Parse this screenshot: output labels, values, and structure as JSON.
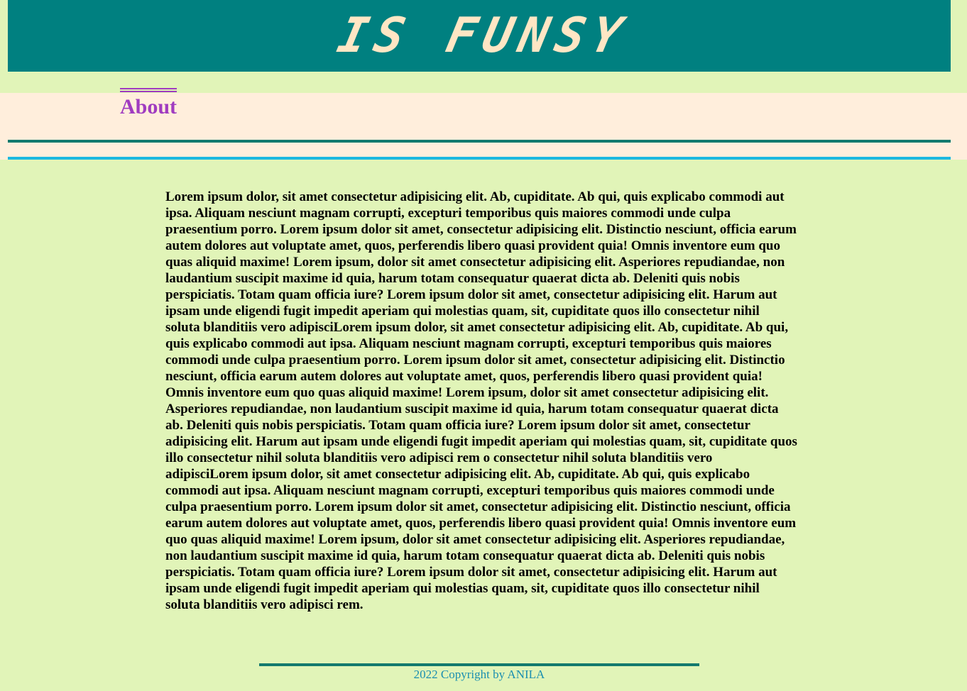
{
  "header": {
    "title": "IS FUNSY",
    "background": "#008080",
    "text_color": "#ffe6c4"
  },
  "nav": {
    "about_label": "About",
    "link_color": "#a03cc0",
    "band_color": "#ffeedc"
  },
  "main": {
    "body_text": "Lorem ipsum dolor, sit amet consectetur adipisicing elit. Ab, cupiditate. Ab qui, quis explicabo commodi aut ipsa. Aliquam nesciunt magnam corrupti, excepturi temporibus quis maiores commodi unde culpa praesentium porro. Lorem ipsum dolor sit amet, consectetur adipisicing elit. Distinctio nesciunt, officia earum autem dolores aut voluptate amet, quos, perferendis libero quasi provident quia! Omnis inventore eum quo quas aliquid maxime! Lorem ipsum, dolor sit amet consectetur adipisicing elit. Asperiores repudiandae, non laudantium suscipit maxime id quia, harum totam consequatur quaerat dicta ab. Deleniti quis nobis perspiciatis. Totam quam officia iure? Lorem ipsum dolor sit amet, consectetur adipisicing elit. Harum aut ipsam unde eligendi fugit impedit aperiam qui molestias quam, sit, cupiditate quos illo consectetur nihil soluta blanditiis vero adipisciLorem ipsum dolor, sit amet consectetur adipisicing elit. Ab, cupiditate. Ab qui, quis explicabo commodi aut ipsa. Aliquam nesciunt magnam corrupti, excepturi temporibus quis maiores commodi unde culpa praesentium porro. Lorem ipsum dolor sit amet, consectetur adipisicing elit. Distinctio nesciunt, officia earum autem dolores aut voluptate amet, quos, perferendis libero quasi provident quia! Omnis inventore eum quo quas aliquid maxime! Lorem ipsum, dolor sit amet consectetur adipisicing elit. Asperiores repudiandae, non laudantium suscipit maxime id quia, harum totam consequatur quaerat dicta ab. Deleniti quis nobis perspiciatis. Totam quam officia iure? Lorem ipsum dolor sit amet, consectetur adipisicing elit. Harum aut ipsam unde eligendi fugit impedit aperiam qui molestias quam, sit, cupiditate quos illo consectetur nihil soluta blanditiis vero adipisci rem o consectetur nihil soluta blanditiis vero adipisciLorem ipsum dolor, sit amet consectetur adipisicing elit. Ab, cupiditate. Ab qui, quis explicabo commodi aut ipsa. Aliquam nesciunt magnam corrupti, excepturi temporibus quis maiores commodi unde culpa praesentium porro. Lorem ipsum dolor sit amet, consectetur adipisicing elit. Distinctio nesciunt, officia earum autem dolores aut voluptate amet, quos, perferendis libero quasi provident quia! Omnis inventore eum quo quas aliquid maxime! Lorem ipsum, dolor sit amet consectetur adipisicing elit. Asperiores repudiandae, non laudantium suscipit maxime id quia, harum totam consequatur quaerat dicta ab. Deleniti quis nobis perspiciatis. Totam quam officia iure? Lorem ipsum dolor sit amet, consectetur adipisicing elit. Harum aut ipsam unde eligendi fugit impedit aperiam qui molestias quam, sit, cupiditate quos illo consectetur nihil soluta blanditiis vero adipisci rem."
  },
  "footer": {
    "copyright": "2022 Copyright by ANILA",
    "text_color": "#1a8fb0"
  },
  "colors": {
    "page_background": "#e1f4b8",
    "rule_teal": "#137a6e",
    "rule_cyan": "#1db8e0"
  }
}
